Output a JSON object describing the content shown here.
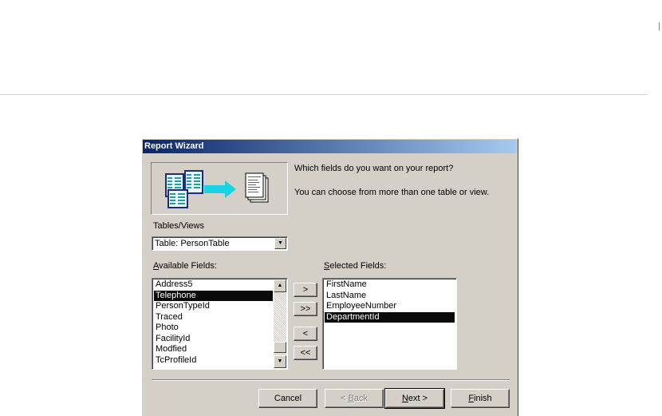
{
  "dialog": {
    "title": "Report Wizard",
    "prompt": "Which fields do you want on your report?",
    "hint": "You can choose from more than one table or view."
  },
  "tables_views": {
    "label": "Tables/Views",
    "selected": "Table: PersonTable"
  },
  "available_fields": {
    "label_accel": "A",
    "label_rest": "vailable Fields:",
    "items": [
      "Address5",
      "Telephone",
      "PersonTypeId",
      "Traced",
      "Photo",
      "FacilityId",
      "Modfied",
      "TcProfileId"
    ],
    "selected_item": "Telephone"
  },
  "selected_fields": {
    "label_accel": "S",
    "label_rest": "elected Fields:",
    "items": [
      "FirstName",
      "LastName",
      "EmployeeNumber",
      "DepartmentId"
    ],
    "selected_item": "DepartmentId"
  },
  "move_buttons": {
    "add_one": ">",
    "add_all": ">>",
    "remove_one": "<",
    "remove_all": "<<"
  },
  "footer": {
    "cancel": "Cancel",
    "back_prefix": "< ",
    "back_accel": "B",
    "back_rest": "ack",
    "next_accel": "N",
    "next_rest": "ext >",
    "finish_accel": "F",
    "finish_rest": "inish"
  },
  "icons": {
    "scroll_up": "▲",
    "scroll_down": "▼",
    "dropdown": "▼"
  },
  "colors": {
    "titlebar_start": "#0a246a",
    "titlebar_end": "#a6caf0",
    "dialog_face": "#d4d0c8",
    "selection": "#0a0a0a"
  }
}
